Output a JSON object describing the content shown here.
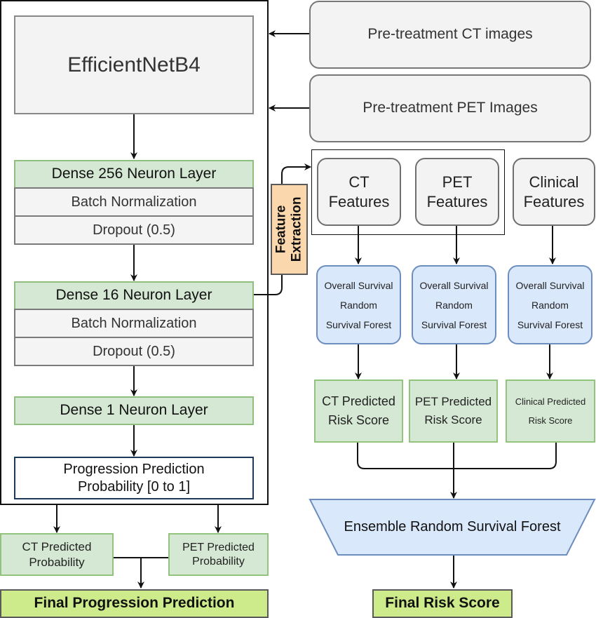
{
  "left_pipeline": {
    "backbone": "EfficientNetB4",
    "block1": {
      "dense": "Dense 256 Neuron Layer",
      "batchnorm": "Batch Normalization",
      "dropout": "Dropout (0.5)"
    },
    "block2": {
      "dense": "Dense 16 Neuron Layer",
      "batchnorm": "Batch Normalization",
      "dropout": "Dropout (0.5)"
    },
    "dense_out": "Dense 1 Neuron Layer",
    "output_line1": "Progression Prediction",
    "output_line2": "Probability [0 to 1]",
    "ct_prob_line1": "CT Predicted",
    "ct_prob_line2": "Probability",
    "pet_prob_line1": "PET Predicted",
    "pet_prob_line2": "Probability",
    "final": "Final Progression Prediction"
  },
  "inputs": {
    "ct": "Pre-treatment CT images",
    "pet": "Pre-treatment PET Images"
  },
  "feature_extraction": {
    "line1": "Feature",
    "line2": "Extraction"
  },
  "features": [
    {
      "line1": "CT",
      "line2": "Features"
    },
    {
      "line1": "PET",
      "line2": "Features"
    },
    {
      "line1": "Clinical",
      "line2": "Features"
    }
  ],
  "forests": [
    {
      "line1": "Overall Survival",
      "line2": "Random",
      "line3": "Survival Forest"
    },
    {
      "line1": "Overall Survival",
      "line2": "Random",
      "line3": "Survival Forest"
    },
    {
      "line1": "Overall Survival",
      "line2": "Random",
      "line3": "Survival Forest"
    }
  ],
  "risk_scores": [
    {
      "line1": "CT Predicted",
      "line2": "Risk Score"
    },
    {
      "line1": "PET Predicted",
      "line2": "Risk Score"
    },
    {
      "line1": "Clinical Predicted",
      "line2": "Risk Score"
    }
  ],
  "ensemble": "Ensemble Random Survival Forest",
  "final_risk": "Final Risk Score",
  "colors": {
    "layer_green": "#d5e8d4",
    "forest_blue": "#dae8fc",
    "feature_extraction_orange": "#fad7ac",
    "final_green": "#cdeb8b",
    "neutral_gray": "#f4f4f4"
  }
}
